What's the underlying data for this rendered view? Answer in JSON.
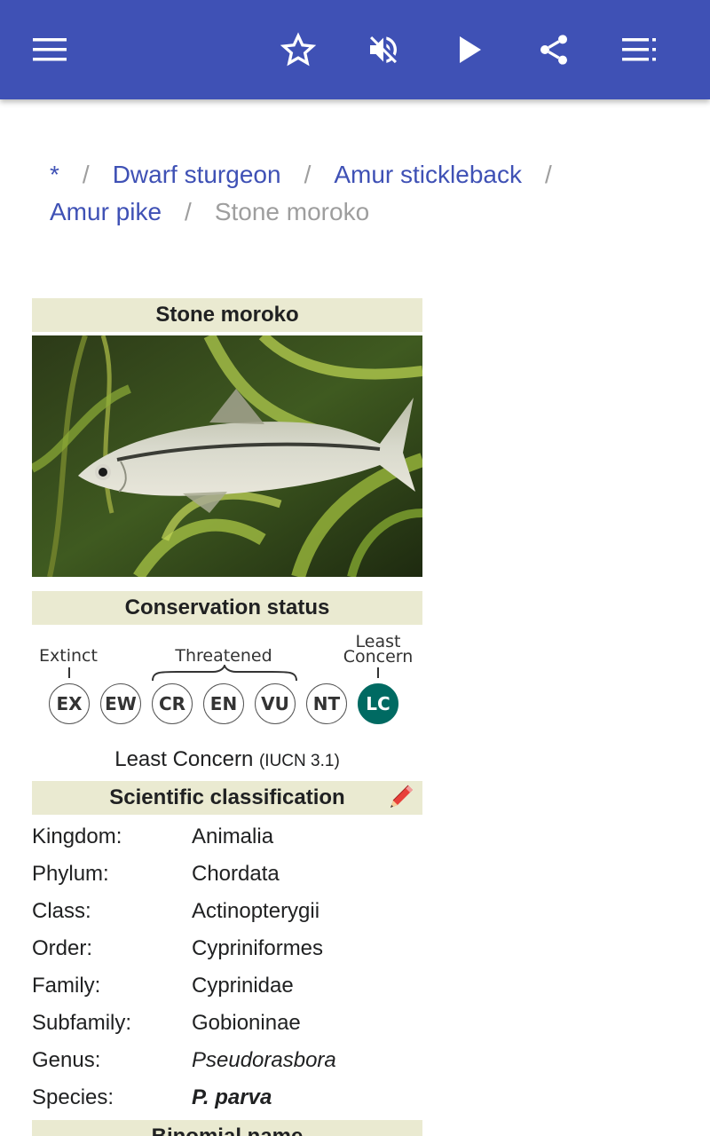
{
  "toolbar": {
    "menu_icon": "hamburger-menu-icon",
    "favorite_icon": "star-outline-icon",
    "sound_icon": "volume-off-icon",
    "play_icon": "play-icon",
    "share_icon": "share-icon",
    "toc_icon": "list-icon",
    "color": "#3f51b5"
  },
  "breadcrumb": {
    "items": [
      "*",
      "Dwarf sturgeon",
      "Amur stickleback",
      "Amur pike"
    ],
    "separator": "/",
    "current": "Stone moroko"
  },
  "infobox": {
    "title": "Stone moroko",
    "image_description": "fish-photo",
    "conservation_header": "Conservation status",
    "scale": {
      "extinct_label": "Extinct",
      "threatened_label": "Threatened",
      "least_concern_label_line1": "Least",
      "least_concern_label_line2": "Concern",
      "categories": [
        "EX",
        "EW",
        "CR",
        "EN",
        "VU",
        "NT",
        "LC"
      ],
      "active": "LC",
      "active_color": "#006a62"
    },
    "status": "Least Concern",
    "status_source": "(IUCN 3.1)",
    "classification_header": "Scientific classification",
    "edit_icon": "pencil-icon",
    "taxonomy": [
      {
        "rank": "Kingdom:",
        "value": "Animalia"
      },
      {
        "rank": "Phylum:",
        "value": "Chordata"
      },
      {
        "rank": "Class:",
        "value": "Actinopterygii"
      },
      {
        "rank": "Order:",
        "value": "Cypriniformes"
      },
      {
        "rank": "Family:",
        "value": "Cyprinidae"
      },
      {
        "rank": "Subfamily:",
        "value": "Gobioninae"
      },
      {
        "rank": "Genus:",
        "value": "Pseudorasbora"
      },
      {
        "rank": "Species:",
        "value": "P. parva"
      }
    ],
    "binomial_header": "Binomial name",
    "header_color": "#eaead1"
  }
}
